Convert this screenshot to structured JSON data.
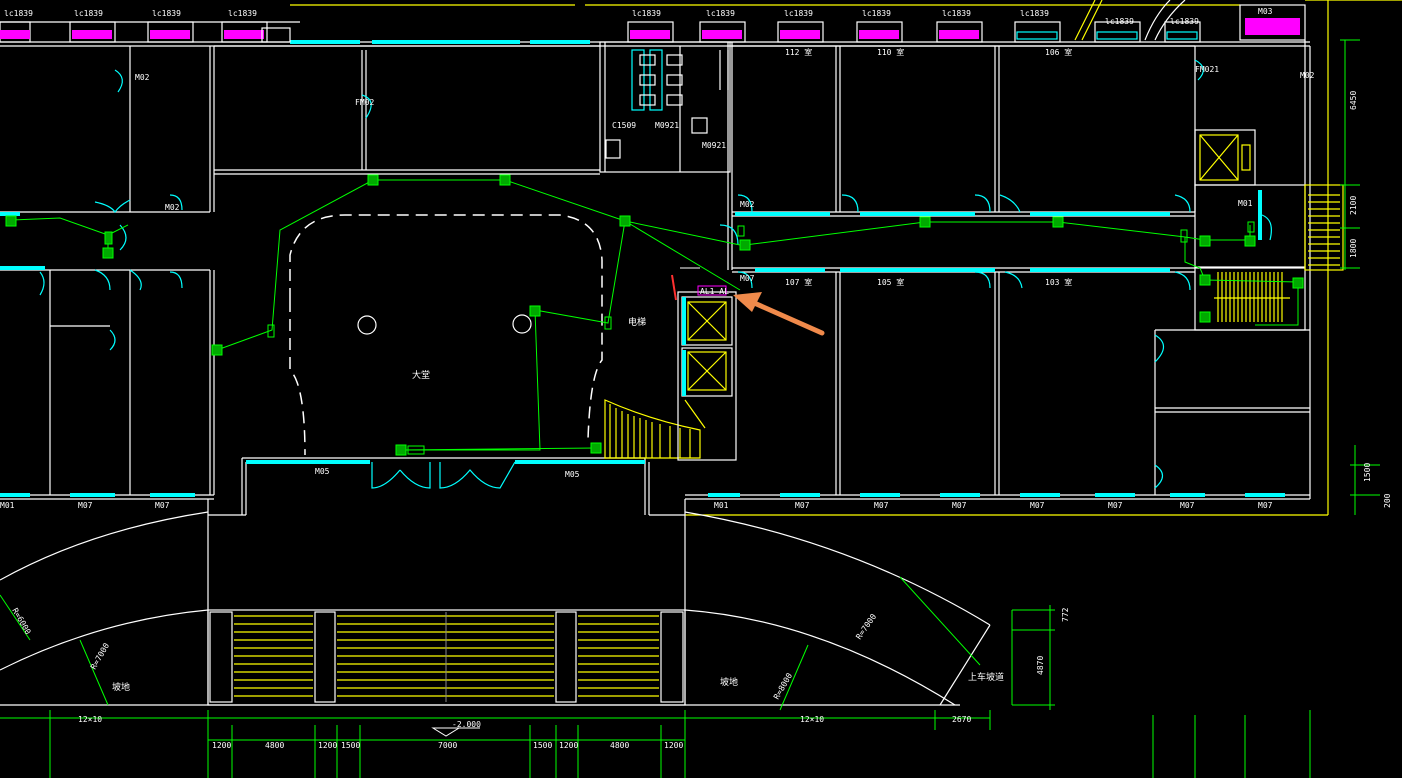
{
  "window_labels_top": [
    "lc1839",
    "lc1839",
    "lc1839",
    "lc1839",
    "lc1839",
    "lc1839",
    "lc1839",
    "lc1839",
    "lc1839",
    "lc1839",
    "lc1839",
    "lc1839"
  ],
  "room_codes": {
    "r112": "112 室",
    "r110": "110 室",
    "r106": "106 室",
    "r107": "107 室",
    "r105": "105 室",
    "r103": "103 室"
  },
  "doors": {
    "m02_a": "M02",
    "m02_b": "M02",
    "m02_c": "M02",
    "m02_d": "M02",
    "m01": "M01",
    "m05_a": "M05",
    "m05_b": "M05",
    "m07": "M07",
    "m03": "M03",
    "fm02": "FM02",
    "fm021": "FM021",
    "m0921": "M0921",
    "c1509": "C1509"
  },
  "bottom_doors": [
    "M01",
    "M07",
    "M07",
    "M01",
    "M07",
    "M07",
    "M07",
    "M07",
    "M07",
    "M07",
    "M07"
  ],
  "labels": {
    "lobby": "大堂",
    "lift_lobby": "电梯",
    "slope_left": "坡地",
    "slope_right": "坡地",
    "car_ramp": "上车坡道",
    "panel": "AL1 AL",
    "radius_left": "R=6000",
    "radius_mid": "R=7000",
    "radius_right": "R=8000",
    "radius_r2": "R=7000",
    "elev": "-2.000"
  },
  "dims_bottom": [
    "12×10",
    "1200",
    "4800",
    "1200",
    "1500",
    "7000",
    "1500",
    "1200",
    "4800",
    "1200",
    "12×10",
    "2670"
  ],
  "dims_right": [
    "6450",
    "2100",
    "1800",
    "1500",
    "200"
  ],
  "dims_mid_right": [
    "4870",
    "772"
  ],
  "colors": {
    "wall": "#ffffff",
    "window": "#00ffff",
    "dimension": "#00ff00",
    "device": "#00ff00",
    "stair": "#ffff00",
    "arrow": "#f08a4b",
    "highlight": "#ff00ff"
  }
}
